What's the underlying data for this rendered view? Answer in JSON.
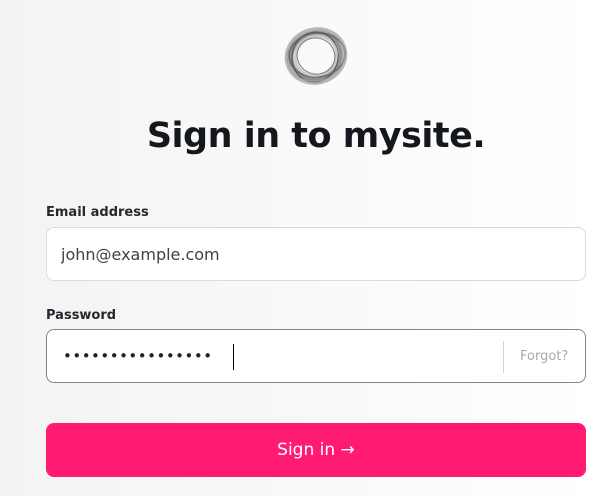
{
  "brand": {
    "logo_icon": "ring-logo-icon"
  },
  "title": "Sign in to mysite.",
  "email": {
    "label": "Email address",
    "value": "john@example.com",
    "placeholder": ""
  },
  "password": {
    "label": "Password",
    "value": "••••••••••••••••",
    "forgot_label": "Forgot?"
  },
  "submit": {
    "label": "Sign in →"
  },
  "colors": {
    "accent": "#ff1a72",
    "border": "#d8dce1",
    "focus_border": "#7d8591",
    "muted_text": "#a6abb3"
  }
}
